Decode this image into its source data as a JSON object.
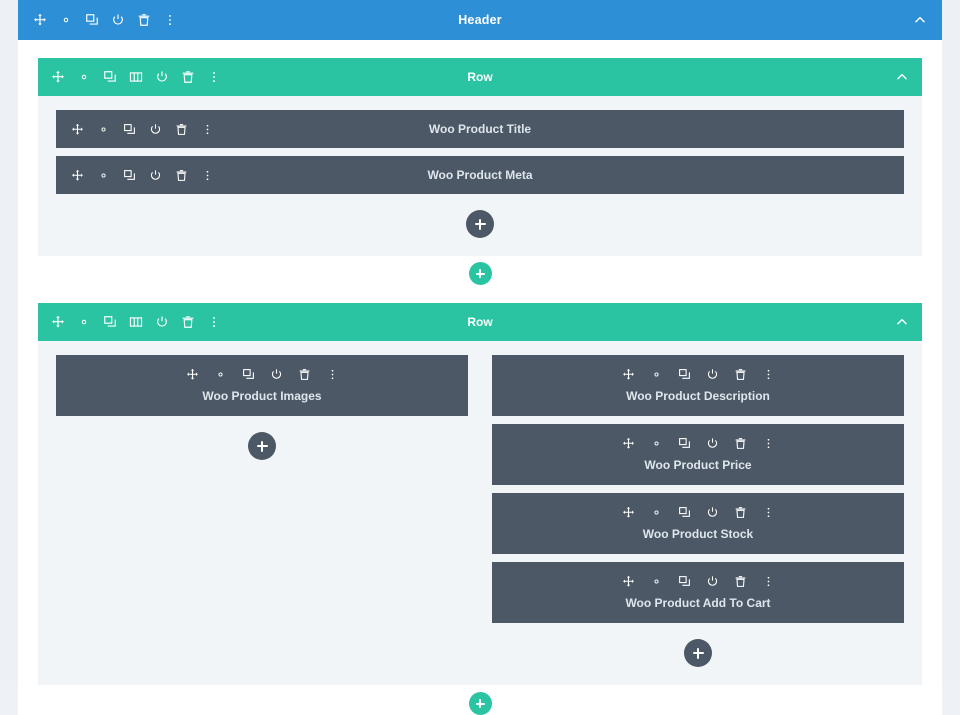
{
  "page": {
    "background": "#edf1f5",
    "canvas_background": "#ffffff"
  },
  "colors": {
    "section": "#2d8fd5",
    "row": "#2bc4a2",
    "module": "#4c5866",
    "row_body": "#f2f5f8",
    "module_label": "#dfe5ec"
  },
  "section": {
    "label": "Header",
    "collapse_icon": "chevron-up-icon",
    "toolbar": [
      {
        "name": "move-icon",
        "title": "Move Section"
      },
      {
        "name": "gear-icon",
        "title": "Section Settings"
      },
      {
        "name": "duplicate-icon",
        "title": "Duplicate Section"
      },
      {
        "name": "power-icon",
        "title": "Disable Section"
      },
      {
        "name": "trash-icon",
        "title": "Delete Section"
      },
      {
        "name": "kebab-icon",
        "title": "More Options"
      }
    ]
  },
  "rows": [
    {
      "label": "Row",
      "collapse_icon": "chevron-up-icon",
      "toolbar": [
        {
          "name": "move-icon",
          "title": "Move Row"
        },
        {
          "name": "gear-icon",
          "title": "Row Settings"
        },
        {
          "name": "duplicate-icon",
          "title": "Duplicate Row"
        },
        {
          "name": "columns-icon",
          "title": "Change Column Structure"
        },
        {
          "name": "power-icon",
          "title": "Disable Row"
        },
        {
          "name": "trash-icon",
          "title": "Delete Row"
        },
        {
          "name": "kebab-icon",
          "title": "More Options"
        }
      ],
      "layout": "single",
      "modules": [
        {
          "label": "Woo Product Title"
        },
        {
          "label": "Woo Product Meta"
        }
      ],
      "add_module_label": "+",
      "add_row_label": "+"
    },
    {
      "label": "Row",
      "collapse_icon": "chevron-up-icon",
      "toolbar": [
        {
          "name": "move-icon",
          "title": "Move Row"
        },
        {
          "name": "gear-icon",
          "title": "Row Settings"
        },
        {
          "name": "duplicate-icon",
          "title": "Duplicate Row"
        },
        {
          "name": "columns-icon",
          "title": "Change Column Structure"
        },
        {
          "name": "power-icon",
          "title": "Disable Row"
        },
        {
          "name": "trash-icon",
          "title": "Delete Row"
        },
        {
          "name": "kebab-icon",
          "title": "More Options"
        }
      ],
      "layout": "two-column",
      "columns": [
        {
          "modules": [
            {
              "label": "Woo Product Images"
            }
          ]
        },
        {
          "modules": [
            {
              "label": "Woo Product Description"
            },
            {
              "label": "Woo Product Price"
            },
            {
              "label": "Woo Product Stock"
            },
            {
              "label": "Woo Product Add To Cart"
            }
          ]
        }
      ],
      "add_module_label": "+",
      "add_row_label": "+"
    }
  ],
  "module_toolbar": [
    {
      "name": "move-icon",
      "title": "Move Module"
    },
    {
      "name": "gear-icon",
      "title": "Module Settings"
    },
    {
      "name": "duplicate-icon",
      "title": "Duplicate Module"
    },
    {
      "name": "power-icon",
      "title": "Disable Module"
    },
    {
      "name": "trash-icon",
      "title": "Delete Module"
    },
    {
      "name": "kebab-icon",
      "title": "More Options"
    }
  ]
}
